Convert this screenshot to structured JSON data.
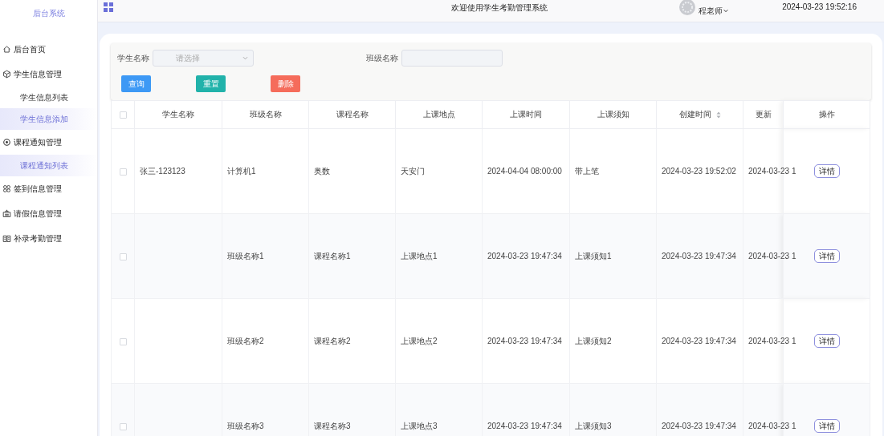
{
  "sidebar": {
    "title": "后台系统",
    "items": [
      {
        "label": "后台首页"
      },
      {
        "label": "学生信息管理",
        "children": [
          {
            "label": "学生信息列表",
            "highlighted": false
          },
          {
            "label": "学生信息添加",
            "highlighted": true
          }
        ]
      },
      {
        "label": "课程通知管理",
        "children": [
          {
            "label": "课程通知列表",
            "highlighted": true
          }
        ]
      },
      {
        "label": "签到信息管理"
      },
      {
        "label": "请假信息管理"
      },
      {
        "label": "补录考勤管理"
      }
    ]
  },
  "header": {
    "title": "欢迎使用学生考勤管理系统",
    "user": "程老师",
    "datetime": "2024-03-23 19:52:16"
  },
  "search": {
    "fields": [
      {
        "label": "学生名称",
        "kind": "select",
        "placeholder": "请选择"
      },
      {
        "label": "班级名称",
        "kind": "input"
      }
    ],
    "buttons": [
      {
        "label": "查询",
        "kind": "primary"
      },
      {
        "label": "重置",
        "kind": "success"
      },
      {
        "label": "删除",
        "kind": "danger"
      }
    ]
  },
  "table": {
    "select_all": {
      "checked": false
    },
    "columns": [
      {
        "label": "学生名称",
        "sortable": false
      },
      {
        "label": "班级名称",
        "sortable": false
      },
      {
        "label": "课程名称",
        "sortable": false
      },
      {
        "label": "上课地点",
        "sortable": false
      },
      {
        "label": "上课时间",
        "sortable": false
      },
      {
        "label": "上课须知",
        "sortable": false
      },
      {
        "label": "创建时间",
        "sortable": true
      },
      {
        "label": "更新",
        "sortable": false
      },
      {
        "label": "操作",
        "sortable": false
      }
    ],
    "rows": [
      {
        "checked": false,
        "cells": [
          "张三-123123",
          "计算机1",
          "奥数",
          "天安门",
          "2024-04-04 08:00:00",
          "带上笔",
          "2024-03-23 19:52:02",
          "2024-03-23 1"
        ],
        "action": "详情"
      },
      {
        "checked": false,
        "cells": [
          "",
          "班级名称1",
          "课程名称1",
          "上课地点1",
          "2024-03-23 19:47:34",
          "上课须知1",
          "2024-03-23 19:47:34",
          "2024-03-23 1"
        ],
        "action": "详情"
      },
      {
        "checked": false,
        "cells": [
          "",
          "班级名称2",
          "课程名称2",
          "上课地点2",
          "2024-03-23 19:47:34",
          "上课须知2",
          "2024-03-23 19:47:34",
          "2024-03-23 1"
        ],
        "action": "详情"
      },
      {
        "checked": false,
        "cells": [
          "",
          "班级名称3",
          "课程名称3",
          "上课地点3",
          "2024-03-23 19:47:34",
          "上课须知3",
          "2024-03-23 19:47:34",
          "2024-03-23 1"
        ],
        "action": "详情"
      }
    ]
  }
}
